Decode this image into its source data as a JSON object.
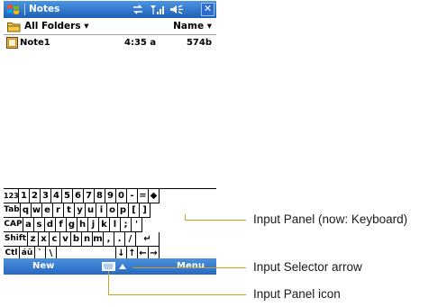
{
  "titlebar": {
    "title": "Notes",
    "icons": [
      "windows-flag-icon",
      "connectivity-icon",
      "signal-icon",
      "volume-icon"
    ],
    "close_label": "✕"
  },
  "folderbar": {
    "folder_label": "All Folders ▾",
    "sort_label": "Name ▾"
  },
  "notes": [
    {
      "name": "Note1",
      "time": "4:35 a",
      "size": "574b"
    }
  ],
  "keyboard": {
    "rows": [
      [
        "123",
        "1",
        "2",
        "3",
        "4",
        "5",
        "6",
        "7",
        "8",
        "9",
        "0",
        "-",
        "=",
        "◆"
      ],
      [
        "Tab",
        "q",
        "w",
        "e",
        "r",
        "t",
        "y",
        "u",
        "i",
        "o",
        "p",
        "[",
        "]"
      ],
      [
        "CAP",
        "a",
        "s",
        "d",
        "f",
        "g",
        "h",
        "j",
        "k",
        "l",
        ";",
        "'"
      ],
      [
        "Shift",
        "z",
        "x",
        "c",
        "v",
        "b",
        "n",
        "m",
        ",",
        ".",
        "/",
        "↵"
      ],
      [
        "Ctl",
        "áü",
        "`",
        "\\",
        "",
        "↓",
        "↑",
        "←",
        "→"
      ]
    ]
  },
  "menubar": {
    "left_label": "New",
    "right_label": "Menu"
  },
  "annotations": {
    "input_panel": "Input Panel (now: Keyboard)",
    "input_selector": "Input Selector arrow",
    "input_panel_icon": "Input Panel icon"
  },
  "colors": {
    "titlebar": "#1e5fb8",
    "menubar": "#2768c4",
    "callout": "#c9a31c"
  }
}
